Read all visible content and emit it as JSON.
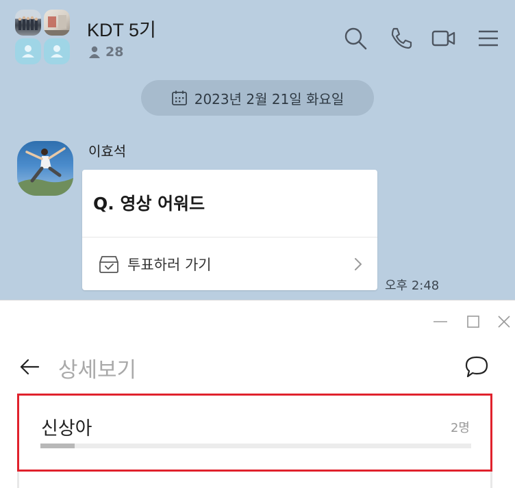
{
  "chat": {
    "room_title": "KDT 5기",
    "member_count": "28",
    "date_label": "2023년 2월 21일 화요일",
    "sender_name": "이효석",
    "poll": {
      "question": "Q. 영상 어워드",
      "action_label": "투표하러 가기"
    },
    "message_time": "오후 2:48",
    "header_icons": [
      "search-icon",
      "phone-icon",
      "video-icon",
      "menu-icon"
    ]
  },
  "detail": {
    "title": "상세보기",
    "window_controls": [
      "minimize-icon",
      "maximize-icon",
      "close-icon"
    ],
    "option": {
      "name": "신상아",
      "count_label": "2명",
      "progress_fraction": 0.08
    }
  },
  "colors": {
    "chat_background": "#bacee0",
    "highlight_border": "#e0212c",
    "progress_fill": "#b8b8b8"
  }
}
